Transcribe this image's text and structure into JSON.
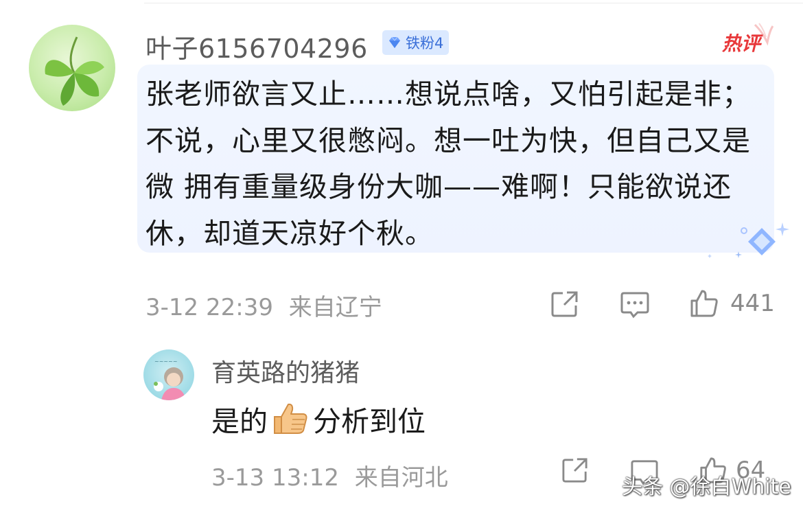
{
  "main_comment": {
    "username": "叶子6156704296",
    "fan_badge": "铁粉4",
    "hot_tag": "热评",
    "text": "张老师欲言又止……想说点啥，又怕引起是非；不说，心里又很憋闷。想一吐为快，但自己又是微  拥有重量级身份大咖——难啊！只能欲说还休，却道天凉好个秋。",
    "date": "3-12 22:39",
    "location": "来自辽宁",
    "like_count": "441",
    "icons": [
      "share-icon",
      "comment-icon",
      "like-icon"
    ]
  },
  "reply": {
    "username": "育英路的猪猪",
    "text_before": "是的",
    "emoji": "thumbs-up-emoji",
    "text_after": "分析到位",
    "date": "3-13 13:12",
    "location": "来自河北",
    "like_count": "64"
  },
  "watermark": "头条 @徐白White",
  "colors": {
    "bubble": "#eef3ff",
    "badge_bg": "#dbe9ff",
    "badge_text": "#3a6fd8",
    "hot_tag": "#e8383a",
    "meta_text": "#9a9a9a"
  }
}
